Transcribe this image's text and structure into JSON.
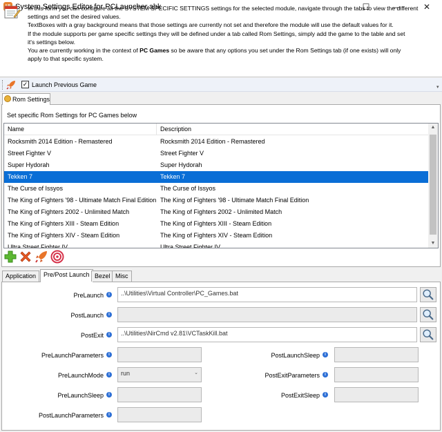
{
  "window": {
    "title": "System Settings Editor for PCLauncher.ahk",
    "app_icon_text": "UI",
    "minimize": "—",
    "maximize": "☐",
    "close": "✕"
  },
  "info": {
    "line1": "In this form you can configure all the SYSTEM SPECIFIC SETTINGS settings for the selected module, navigate through the tabs to view the different",
    "line2": "settings and set the desired values.",
    "line3": "TextBoxes with a gray background means that those settings are currently not set and therefore the module will use the default values for it.",
    "line4": "If the module supports per game specific settings they will be defined under a tab called Rom Settings, simply add the game to the table and set",
    "line5": "it's settings below.",
    "line6_pre": "You are currently working in the context of ",
    "line6_bold": "PC Games",
    "line6_post": " so be aware that any options you set under the Rom Settings tab (if one exists) will only",
    "line7": "apply to that specific system."
  },
  "launch_toolbar": {
    "checkbox_checked": true,
    "checkbox_label": "Launch Previous Game"
  },
  "rom_settings": {
    "tab_label": "Rom Settings",
    "description": "Set specific Rom Settings for PC Games below",
    "columns": [
      "Name",
      "Description"
    ],
    "rows": [
      {
        "name": "Rocksmith 2014 Edition - Remastered",
        "description": "Rocksmith 2014 Edition - Remastered",
        "selected": false
      },
      {
        "name": "Street Fighter V",
        "description": "Street Fighter V",
        "selected": false
      },
      {
        "name": "Super Hydorah",
        "description": "Super Hydorah",
        "selected": false
      },
      {
        "name": "Tekken 7",
        "description": "Tekken 7",
        "selected": true
      },
      {
        "name": "The Curse of Issyos",
        "description": "The Curse of Issyos",
        "selected": false
      },
      {
        "name": "The King of Fighters '98 - Ultimate Match Final Edition",
        "description": "The King of Fighters '98 - Ultimate Match Final Edition",
        "selected": false
      },
      {
        "name": "The King of Fighters 2002 - Unlimited Match",
        "description": "The King of Fighters 2002 - Unlimited Match",
        "selected": false
      },
      {
        "name": "The King of Fighters XIII - Steam Edition",
        "description": "The King of Fighters XIII - Steam Edition",
        "selected": false
      },
      {
        "name": "The King of Fighters XIV - Steam Edition",
        "description": "The King of Fighters XIV - Steam Edition",
        "selected": false
      },
      {
        "name": "Ultra Street Fighter IV",
        "description": "Ultra Street Fighter IV",
        "selected": false
      }
    ],
    "buttons": [
      "add-icon",
      "delete-icon",
      "launch-icon",
      "target-icon"
    ]
  },
  "tabs": [
    {
      "label": "Application",
      "active": false
    },
    {
      "label": "Pre/Post Launch",
      "active": true
    },
    {
      "label": "Bezel",
      "active": false
    },
    {
      "label": "Misc",
      "active": false
    }
  ],
  "fields": {
    "prelaunch": {
      "label": "PreLaunch",
      "value": "..\\Utilities\\Virtual Controller\\PC_Games.bat"
    },
    "postlaunch": {
      "label": "PostLaunch",
      "value": ""
    },
    "postexit": {
      "label": "PostExit",
      "value": "..\\Utilities\\NirCmd v2.81\\VCTaskKill.bat"
    },
    "prelaunch_params": {
      "label": "PreLaunchParameters",
      "value": ""
    },
    "prelaunch_mode": {
      "label": "PreLaunchMode",
      "value": "run"
    },
    "prelaunch_sleep": {
      "label": "PreLaunchSleep",
      "value": ""
    },
    "postlaunch_params": {
      "label": "PostLaunchParameters",
      "value": ""
    },
    "postlaunch_sleep": {
      "label": "PostLaunchSleep",
      "value": ""
    },
    "postexit_params": {
      "label": "PostExitParameters",
      "value": ""
    },
    "postexit_sleep": {
      "label": "PostExitSleep",
      "value": ""
    }
  },
  "info_glyph": "i",
  "colors": {
    "selection": "#0a6ed6",
    "accent_orange": "#e8822f",
    "info_blue": "#2d6fd6"
  }
}
